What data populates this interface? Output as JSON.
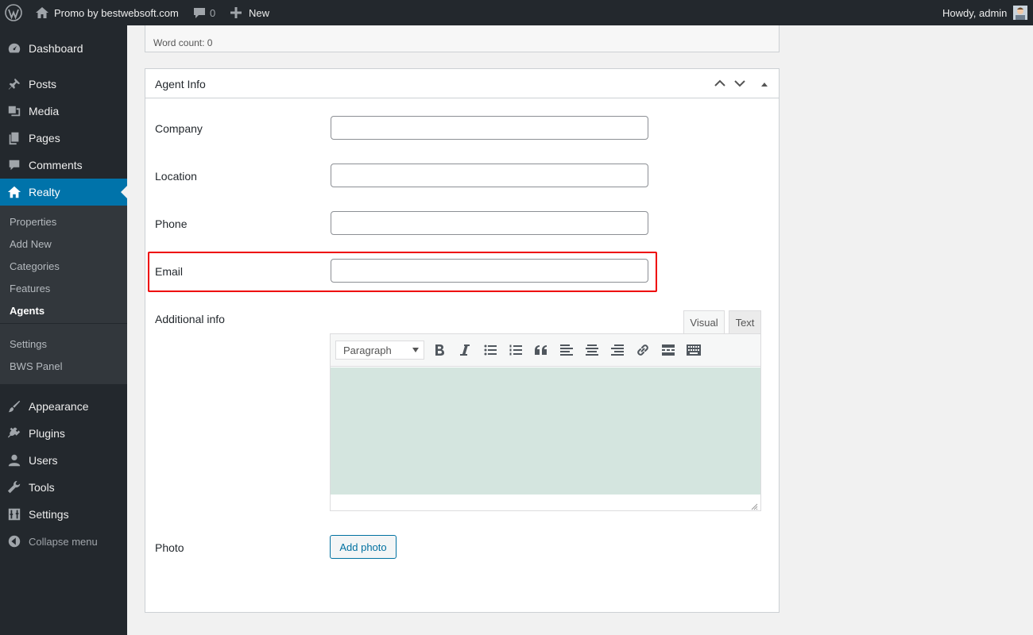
{
  "adminbar": {
    "site_name": "Promo by bestwebsoft.com",
    "comments_count": "0",
    "new_label": "New",
    "howdy": "Howdy, admin"
  },
  "sidebar": {
    "items": [
      {
        "label": "Dashboard",
        "icon": "dashboard-icon"
      },
      {
        "label": "Posts",
        "icon": "pushpin-icon"
      },
      {
        "label": "Media",
        "icon": "media-icon"
      },
      {
        "label": "Pages",
        "icon": "pages-icon"
      },
      {
        "label": "Comments",
        "icon": "comment-icon"
      },
      {
        "label": "Realty",
        "icon": "home-icon"
      },
      {
        "label": "Appearance",
        "icon": "brush-icon"
      },
      {
        "label": "Plugins",
        "icon": "plugin-icon"
      },
      {
        "label": "Users",
        "icon": "user-icon"
      },
      {
        "label": "Tools",
        "icon": "wrench-icon"
      },
      {
        "label": "Settings",
        "icon": "settings-sliders-icon"
      }
    ],
    "submenu": [
      "Properties",
      "Add New",
      "Categories",
      "Features",
      "Agents",
      "Settings",
      "BWS Panel"
    ],
    "collapse_label": "Collapse menu"
  },
  "wordcount": "Word count: 0",
  "agent_info": {
    "title": "Agent Info",
    "fields": {
      "company": {
        "label": "Company",
        "value": ""
      },
      "location": {
        "label": "Location",
        "value": ""
      },
      "phone": {
        "label": "Phone",
        "value": ""
      },
      "email": {
        "label": "Email",
        "value": ""
      }
    },
    "additional_info_label": "Additional info",
    "editor": {
      "tab_visual": "Visual",
      "tab_text": "Text",
      "format_selected": "Paragraph",
      "content": ""
    },
    "photo_label": "Photo",
    "add_photo_label": "Add photo"
  },
  "colors": {
    "accent": "#0073aa",
    "sidebar_bg": "#23282d",
    "submenu_bg": "#32373c",
    "highlight_border": "#ee0000",
    "editor_bg": "#d4e5df"
  }
}
